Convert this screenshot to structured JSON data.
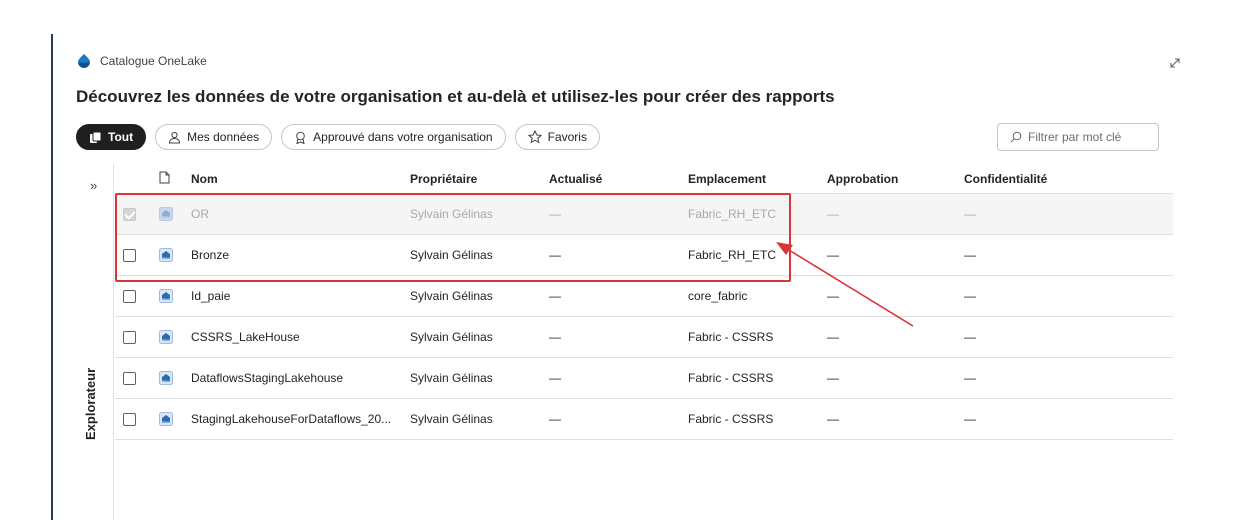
{
  "app": {
    "title": "Catalogue OneLake",
    "logo_icon": "onelake-icon",
    "expand_icon": "expand-diagonal-icon"
  },
  "headline": "Découvrez les données de votre organisation et au-delà et utilisez-les pour créer des rapports",
  "filters": {
    "pills": [
      {
        "label": "Tout",
        "icon": "all-items-icon",
        "active": true
      },
      {
        "label": "Mes données",
        "icon": "person-icon",
        "active": false
      },
      {
        "label": "Approuvé dans votre organisation",
        "icon": "ribbon-icon",
        "active": false
      },
      {
        "label": "Favoris",
        "icon": "star-icon",
        "active": false
      }
    ],
    "search_placeholder": "Filtrer par mot clé"
  },
  "explorer": {
    "label": "Explorateur",
    "chevron": "»"
  },
  "table": {
    "headers": {
      "type_icon": "document-icon",
      "name": "Nom",
      "owner": "Propriétaire",
      "updated": "Actualisé",
      "location": "Emplacement",
      "approval": "Approbation",
      "confidentiality": "Confidentialité"
    },
    "rows": [
      {
        "name": "OR",
        "owner": "Sylvain Gélinas",
        "updated": "—",
        "location": "Fabric_RH_ETC",
        "approval": "—",
        "confidentiality": "—",
        "disabled": true,
        "checked": true
      },
      {
        "name": "Bronze",
        "owner": "Sylvain Gélinas",
        "updated": "—",
        "location": "Fabric_RH_ETC",
        "approval": "—",
        "confidentiality": "—",
        "disabled": false,
        "checked": false
      },
      {
        "name": "Id_paie",
        "owner": "Sylvain Gélinas",
        "updated": "—",
        "location": "core_fabric",
        "approval": "—",
        "confidentiality": "—",
        "disabled": false,
        "checked": false
      },
      {
        "name": "CSSRS_LakeHouse",
        "owner": "Sylvain Gélinas",
        "updated": "—",
        "location": "Fabric - CSSRS",
        "approval": "—",
        "confidentiality": "—",
        "disabled": false,
        "checked": false
      },
      {
        "name": "DataflowsStagingLakehouse",
        "owner": "Sylvain Gélinas",
        "updated": "—",
        "location": "Fabric - CSSRS",
        "approval": "—",
        "confidentiality": "—",
        "disabled": false,
        "checked": false
      },
      {
        "name": "StagingLakehouseForDataflows_20...",
        "owner": "Sylvain Gélinas",
        "updated": "—",
        "location": "Fabric - CSSRS",
        "approval": "—",
        "confidentiality": "—",
        "disabled": false,
        "checked": false
      }
    ],
    "row_icon": "lakehouse-icon"
  },
  "colors": {
    "annotation": "#d9343a",
    "accent": "#1f1f1f",
    "lakehouse": "#2b6cb0"
  }
}
